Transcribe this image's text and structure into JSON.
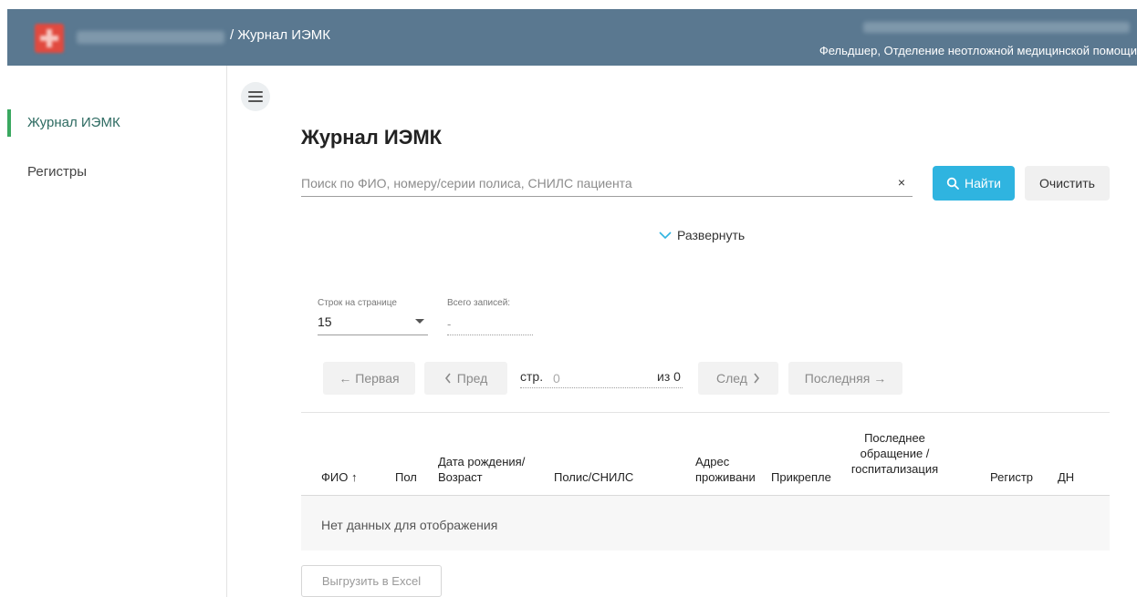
{
  "header": {
    "breadcrumb": "/ Журнал ИЭМК",
    "user_role": "Фельдшер, Отделение неотложной медицинской помощи"
  },
  "sidebar": {
    "items": [
      {
        "label": "Журнал ИЭМК",
        "active": true
      },
      {
        "label": "Регистры",
        "active": false
      }
    ]
  },
  "main": {
    "title": "Журнал ИЭМК",
    "search": {
      "placeholder": "Поиск по ФИО, номеру/серии полиса, СНИЛС пациента",
      "value": "",
      "clear_glyph": "×"
    },
    "find_label": "Найти",
    "clear_label": "Очистить",
    "expand_label": "Развернуть",
    "rows_per_page": {
      "label": "Строк на странице",
      "value": "15"
    },
    "total_records": {
      "label": "Всего записей:",
      "value": "-"
    },
    "pagination": {
      "first": "← Первая",
      "prev": "Пред",
      "page_label": "стр.",
      "page_placeholder": "0",
      "of_label": "из 0",
      "next": "След",
      "last": "Последняя →"
    },
    "table": {
      "columns": [
        "ФИО ↑",
        "Пол",
        "Дата рождения/ Возраст",
        "Полис/СНИЛС",
        "Адрес проживани",
        "Прикрепле",
        "Последнее обращение / госпитализация",
        "Регистр",
        "ДН"
      ],
      "empty_text": "Нет данных для отображения"
    },
    "export_label": "Выгрузить в Excel"
  },
  "colors": {
    "header_bg": "#5a7890",
    "accent": "#2fb4e0",
    "active_nav": "#3aa860"
  }
}
